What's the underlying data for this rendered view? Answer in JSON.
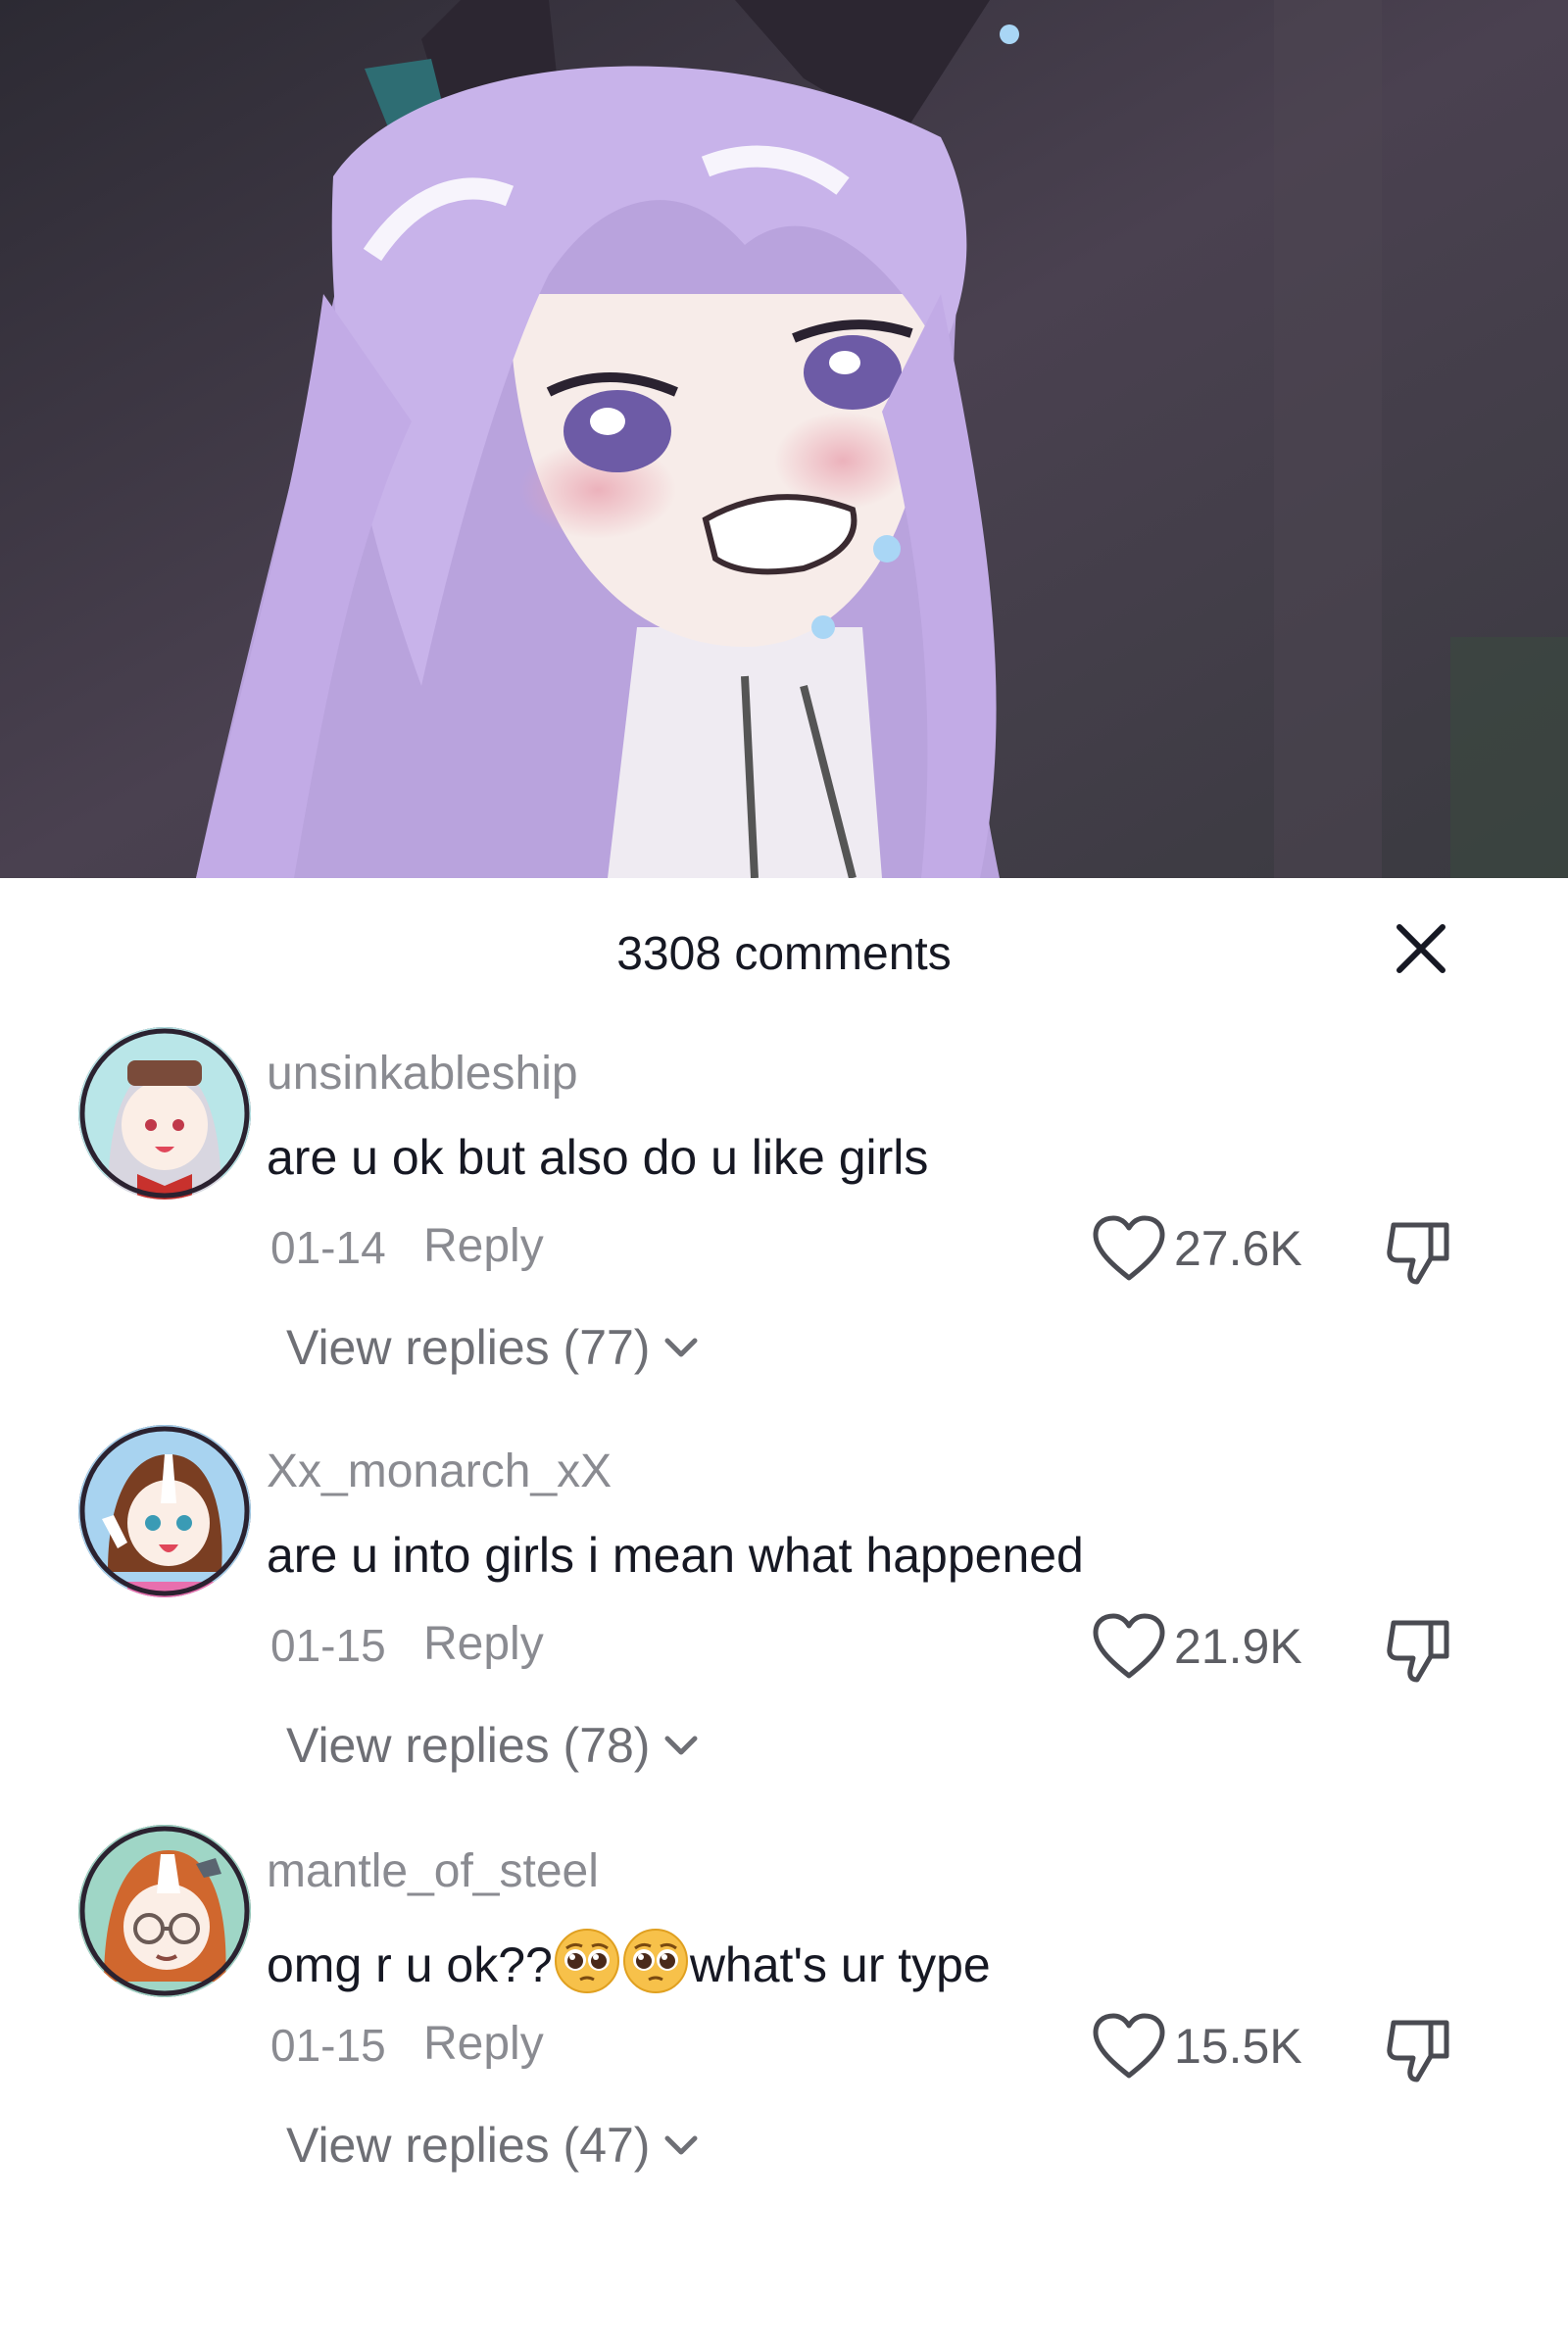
{
  "header": {
    "title": "3308 comments"
  },
  "comments": [
    {
      "username": "unsinkableship",
      "text": "are u ok but also do u like girls",
      "date": "01-14",
      "reply_label": "Reply",
      "likes": "27.6K",
      "view_replies": "View replies (77)"
    },
    {
      "username": "Xx_monarch_xX",
      "text": "are u into girls i mean what happened",
      "date": "01-15",
      "reply_label": "Reply",
      "likes": "21.9K",
      "view_replies": "View replies (78)"
    },
    {
      "username": "mantle_of_steel",
      "text_before": "omg r u ok??",
      "text_after": "what's ur type",
      "emojis": [
        "pleading-face",
        "pleading-face"
      ],
      "date": "01-15",
      "reply_label": "Reply",
      "likes": "15.5K",
      "view_replies": "View replies (47)"
    }
  ],
  "icons": {
    "close": "close-icon",
    "like": "heart-outline-icon",
    "dislike": "thumbs-down-icon",
    "expand": "chevron-down-icon"
  },
  "colors": {
    "text_primary": "#161823",
    "text_secondary": "#8a8b91",
    "background": "#ffffff"
  }
}
